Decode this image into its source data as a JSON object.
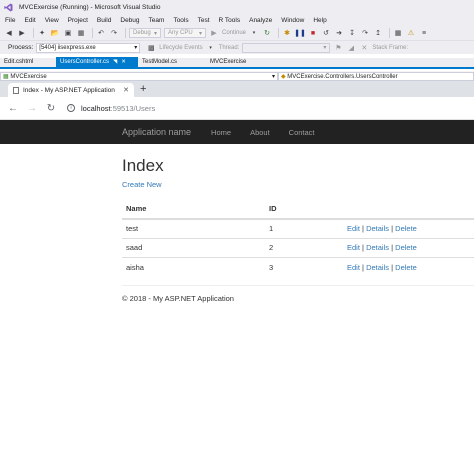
{
  "vs": {
    "title": "MVCExercise (Running) - Microsoft Visual Studio",
    "menu": [
      "File",
      "Edit",
      "View",
      "Project",
      "Build",
      "Debug",
      "Team",
      "Tools",
      "Test",
      "R Tools",
      "Analyze",
      "Window",
      "Help"
    ],
    "toolbar": {
      "config": "Debug",
      "platform": "Any CPU",
      "continue_label": "Continue",
      "stack_frame_label": "Stack Frame:"
    },
    "process_bar": {
      "process_label": "Process:",
      "process_value": "[5404] iisexpress.exe",
      "lifecycle_label": "Lifecycle Events",
      "thread_label": "Thread:"
    },
    "doc_tabs": [
      {
        "label": "Edit.cshtml",
        "active": false
      },
      {
        "label": "UsersController.cs",
        "active": true
      },
      {
        "label": "TestModel.cs",
        "active": false
      },
      {
        "label": "MVCExercise",
        "active": false
      }
    ],
    "nav_combos": {
      "project": "MVCExercise",
      "class": "MVCExercise.Controllers.UsersController"
    },
    "accent_color": "#007acc"
  },
  "browser": {
    "tab_title": "Index - My ASP.NET Application",
    "url_host": "localhost",
    "url_path": ":59513/Users"
  },
  "app": {
    "brand": "Application name",
    "nav_links": [
      "Home",
      "About",
      "Contact"
    ],
    "page_title": "Index",
    "create_new": "Create New",
    "table": {
      "headers": [
        "Name",
        "ID"
      ],
      "rows": [
        {
          "name": "test",
          "id": "1"
        },
        {
          "name": "saad",
          "id": "2"
        },
        {
          "name": "aisha",
          "id": "3"
        }
      ],
      "actions": {
        "edit": "Edit",
        "details": "Details",
        "delete": "Delete",
        "separator": "|"
      }
    },
    "footer": "© 2018 - My ASP.NET Application",
    "link_color": "#337ab7",
    "navbar_color": "#222222"
  }
}
